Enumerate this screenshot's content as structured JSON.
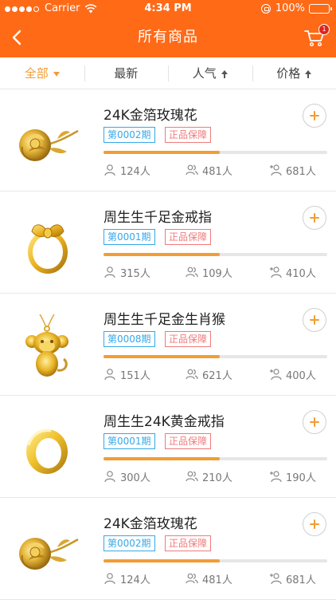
{
  "status_bar": {
    "carrier": "Carrier",
    "time": "4:34 PM",
    "battery": "100%"
  },
  "nav": {
    "title": "所有商品",
    "cart_badge": "1"
  },
  "tabs": [
    {
      "label": "全部",
      "active": true
    },
    {
      "label": "最新",
      "active": false
    },
    {
      "label": "人气",
      "active": false
    },
    {
      "label": "价格",
      "active": false
    }
  ],
  "products": [
    {
      "name": "24K金箔玫瑰花",
      "period": "第0002期",
      "guarantee": "正品保障",
      "progress": 0.52,
      "stat1": "124人",
      "stat2": "481人",
      "stat3": "681人",
      "image": "gold-rose"
    },
    {
      "name": "周生生千足金戒指",
      "period": "第0001期",
      "guarantee": "正品保障",
      "progress": 0.52,
      "stat1": "315人",
      "stat2": "109人",
      "stat3": "410人",
      "image": "gold-bow-ring"
    },
    {
      "name": "周生生千足金生肖猴",
      "period": "第0008期",
      "guarantee": "正品保障",
      "progress": 0.52,
      "stat1": "151人",
      "stat2": "621人",
      "stat3": "400人",
      "image": "gold-monkey-pendant"
    },
    {
      "name": "周生生24K黄金戒指",
      "period": "第0001期",
      "guarantee": "正品保障",
      "progress": 0.52,
      "stat1": "300人",
      "stat2": "210人",
      "stat3": "190人",
      "image": "gold-band-ring"
    },
    {
      "name": "24K金箔玫瑰花",
      "period": "第0002期",
      "guarantee": "正品保障",
      "progress": 0.52,
      "stat1": "124人",
      "stat2": "481人",
      "stat3": "681人",
      "image": "gold-rose"
    }
  ],
  "colors": {
    "header": "#ff6a17",
    "accent": "#f29d34",
    "period_tag": "#36a8e8",
    "guarantee_tag": "#f07a7a",
    "badge": "#e0231c"
  }
}
